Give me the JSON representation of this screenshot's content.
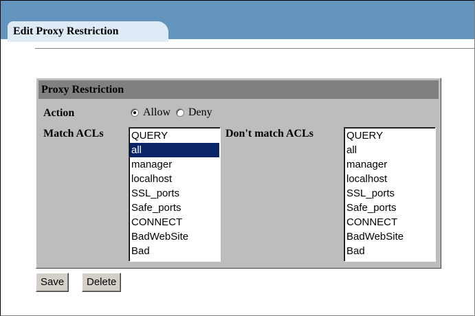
{
  "tab": {
    "label": "Edit Proxy Restriction"
  },
  "panel": {
    "title": "Proxy Restriction",
    "action_label": "Action",
    "options": {
      "allow": "Allow",
      "deny": "Deny",
      "selected": "Allow"
    },
    "match_label": "Match ACLs",
    "dont_match_label": "Don't match ACLs",
    "match_acls": [
      "QUERY",
      "all",
      "manager",
      "localhost",
      "SSL_ports",
      "Safe_ports",
      "CONNECT",
      "BadWebSite",
      "Bad"
    ],
    "match_selected": "all",
    "dont_match_acls": [
      "QUERY",
      "all",
      "manager",
      "localhost",
      "SSL_ports",
      "Safe_ports",
      "CONNECT",
      "BadWebSite",
      "Bad"
    ]
  },
  "buttons": {
    "save": "Save",
    "delete": "Delete"
  },
  "colors": {
    "tabbar": "#6394bd",
    "tab": "#deebf7",
    "panel": "#bdbdbd",
    "header": "#808080",
    "selection": "#0a246a"
  }
}
